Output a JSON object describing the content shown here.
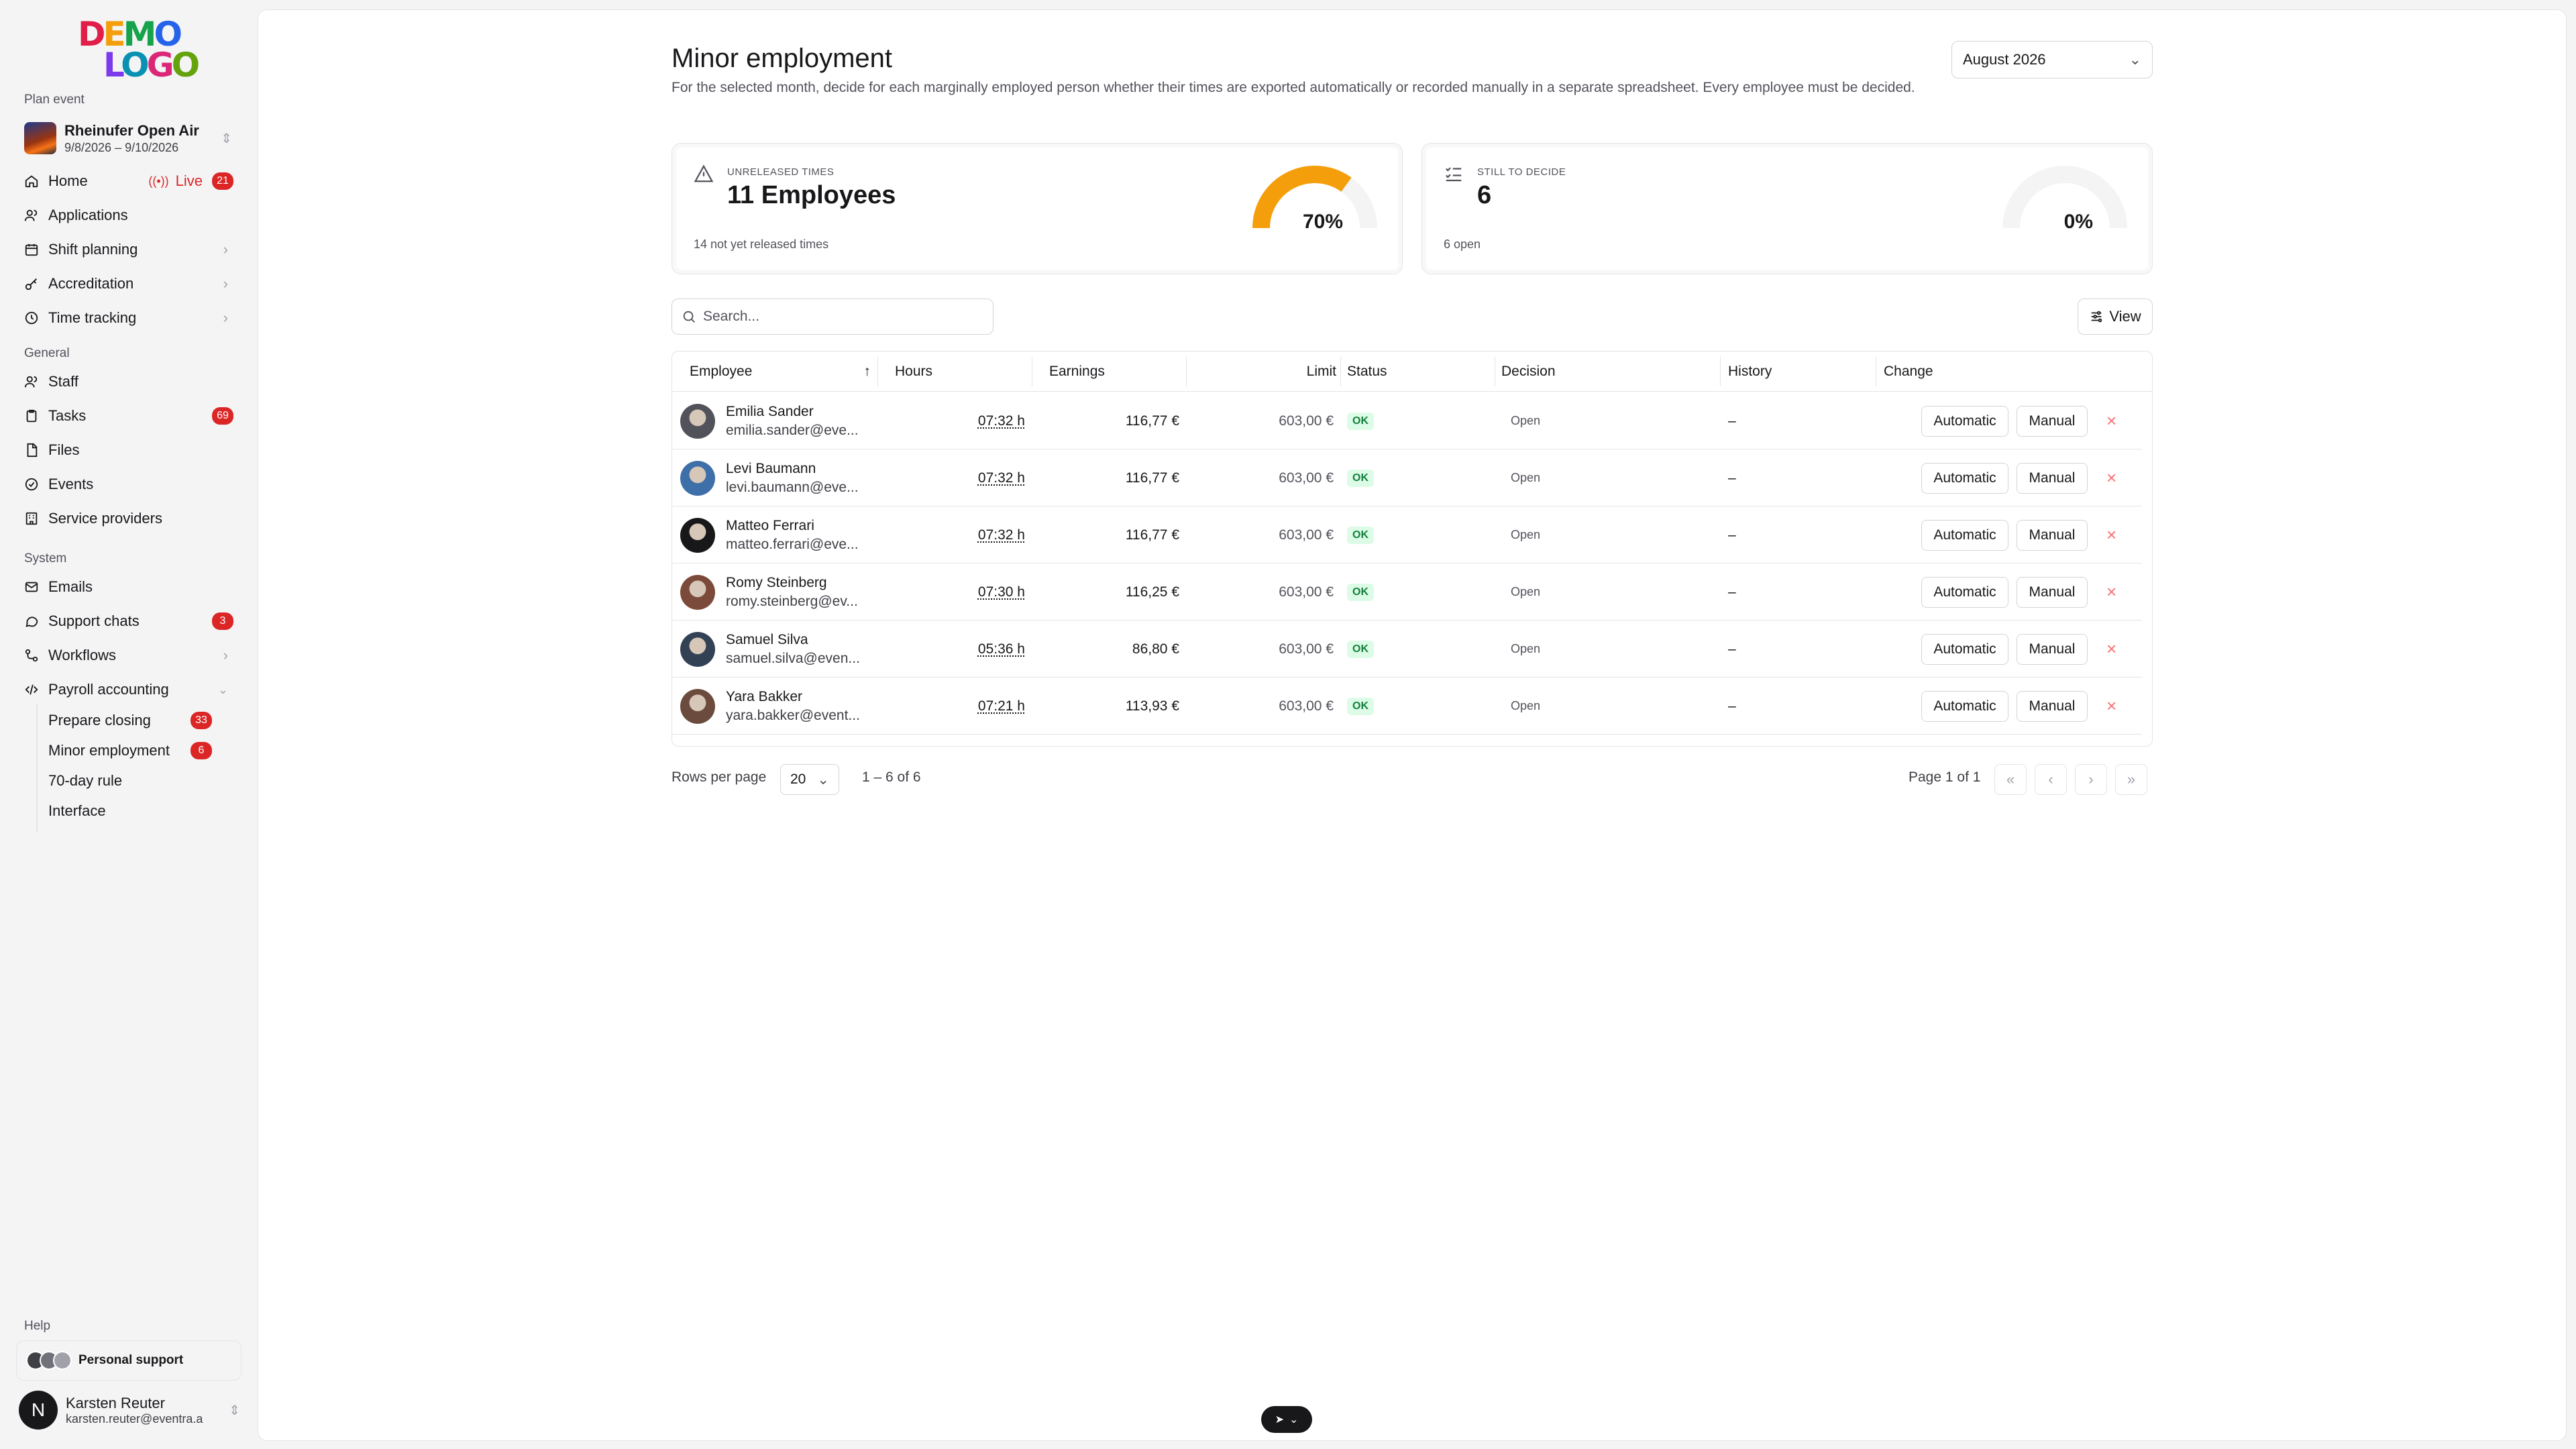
{
  "sidebar": {
    "logo": {
      "line1": "DEMO",
      "line2": "LOGO"
    },
    "plan_event_label": "Plan event",
    "event": {
      "name": "Rheinufer Open Air",
      "dates": "9/8/2026 – 9/10/2026"
    },
    "plan_items": [
      {
        "label": "Home",
        "live": "Live",
        "badge": "21"
      },
      {
        "label": "Applications"
      },
      {
        "label": "Shift planning"
      },
      {
        "label": "Accreditation"
      },
      {
        "label": "Time tracking"
      }
    ],
    "general_label": "General",
    "general_items": [
      {
        "label": "Staff"
      },
      {
        "label": "Tasks",
        "badge": "69"
      },
      {
        "label": "Files"
      },
      {
        "label": "Events"
      },
      {
        "label": "Service providers"
      }
    ],
    "system_label": "System",
    "system_items": [
      {
        "label": "Emails"
      },
      {
        "label": "Support chats",
        "badge": "3"
      },
      {
        "label": "Workflows"
      },
      {
        "label": "Payroll accounting"
      }
    ],
    "payroll_sub": [
      {
        "label": "Prepare closing",
        "badge": "33"
      },
      {
        "label": "Minor employment",
        "badge": "6"
      },
      {
        "label": "70-day rule"
      },
      {
        "label": "Interface"
      }
    ],
    "help_label": "Help",
    "support_label": "Personal support",
    "user": {
      "initial": "N",
      "name": "Karsten Reuter",
      "email": "karsten.reuter@eventra.a"
    }
  },
  "page": {
    "title": "Minor employment",
    "description": "For the selected month, decide for each marginally employed person whether their times are exported automatically or recorded manually in a separate spreadsheet. Every employee must be decided.",
    "month": "August 2026"
  },
  "cards": [
    {
      "label": "Unreleased times",
      "value": "11 Employees",
      "foot": "14 not yet released times",
      "percent": 70,
      "percent_label": "70%",
      "color": "#f59e0b"
    },
    {
      "label": "Still to decide",
      "value": "6",
      "foot": "6 open",
      "percent": 0,
      "percent_label": "0%",
      "color": "#f59e0b"
    }
  ],
  "search": {
    "placeholder": "Search..."
  },
  "view_label": "View",
  "table": {
    "headers": {
      "employee": "Employee",
      "hours": "Hours",
      "earnings": "Earnings",
      "limit": "Limit",
      "status": "Status",
      "decision": "Decision",
      "history": "History",
      "change": "Change"
    },
    "automatic_label": "Automatic",
    "manual_label": "Manual",
    "rows": [
      {
        "name": "Emilia Sander",
        "email": "emilia.sander@eve...",
        "hours": "07:32 h",
        "earnings": "116,77 €",
        "limit": "603,00 €",
        "status": "OK",
        "decision": "Open",
        "history": "–"
      },
      {
        "name": "Levi Baumann",
        "email": "levi.baumann@eve...",
        "hours": "07:32 h",
        "earnings": "116,77 €",
        "limit": "603,00 €",
        "status": "OK",
        "decision": "Open",
        "history": "–"
      },
      {
        "name": "Matteo Ferrari",
        "email": "matteo.ferrari@eve...",
        "hours": "07:32 h",
        "earnings": "116,77 €",
        "limit": "603,00 €",
        "status": "OK",
        "decision": "Open",
        "history": "–"
      },
      {
        "name": "Romy Steinberg",
        "email": "romy.steinberg@ev...",
        "hours": "07:30 h",
        "earnings": "116,25 €",
        "limit": "603,00 €",
        "status": "OK",
        "decision": "Open",
        "history": "–"
      },
      {
        "name": "Samuel Silva",
        "email": "samuel.silva@even...",
        "hours": "05:36 h",
        "earnings": "86,80 €",
        "limit": "603,00 €",
        "status": "OK",
        "decision": "Open",
        "history": "–"
      },
      {
        "name": "Yara Bakker",
        "email": "yara.bakker@event...",
        "hours": "07:21 h",
        "earnings": "113,93 €",
        "limit": "603,00 €",
        "status": "OK",
        "decision": "Open",
        "history": "–"
      }
    ]
  },
  "pagination": {
    "rows_per_page_label": "Rows per page",
    "rows_per_page": "20",
    "range": "1 – 6 of 6",
    "page_label": "Page 1 of 1"
  }
}
